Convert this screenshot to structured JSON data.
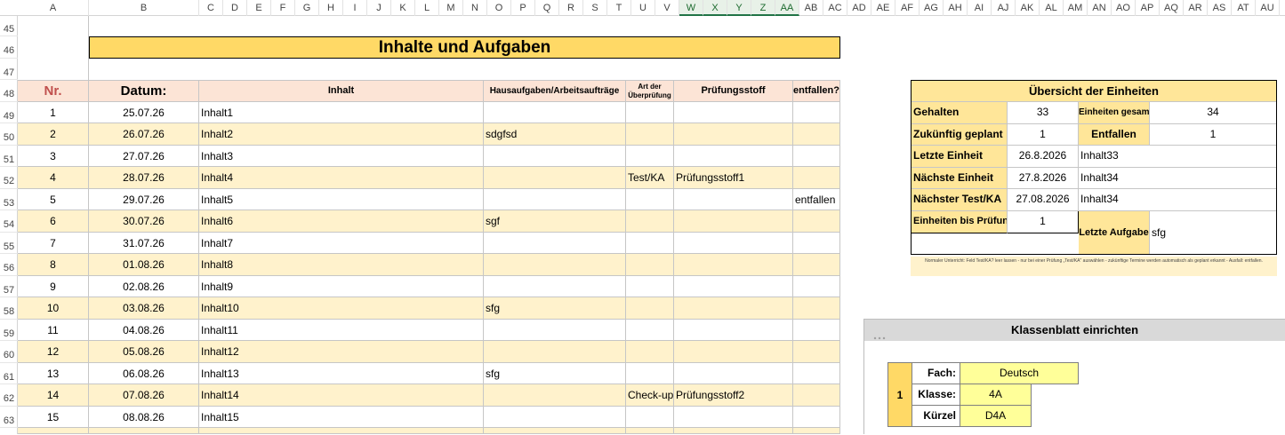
{
  "columns": [
    "A",
    "B",
    "C",
    "D",
    "E",
    "F",
    "G",
    "H",
    "I",
    "J",
    "K",
    "L",
    "M",
    "N",
    "O",
    "P",
    "Q",
    "R",
    "S",
    "T",
    "U",
    "V",
    "W",
    "X",
    "Y",
    "Z",
    "AA",
    "AB",
    "AC",
    "AD",
    "AE",
    "AF",
    "AG",
    "AH",
    "AI",
    "AJ",
    "AK",
    "AL",
    "AM",
    "AN",
    "AO",
    "AP",
    "AQ",
    "AR",
    "AS",
    "AT",
    "AU"
  ],
  "rows": [
    "45",
    "46",
    "47",
    "48",
    "49",
    "50",
    "51",
    "52",
    "53",
    "54",
    "55",
    "56",
    "57",
    "58",
    "59",
    "60",
    "61",
    "62",
    "63"
  ],
  "title": "Inhalte und Aufgaben",
  "table": {
    "headers": {
      "nr": "Nr.",
      "datum": "Datum:",
      "inhalt": "Inhalt",
      "hausaufgaben": "Hausaufgaben/Arbeitsaufträge",
      "art_line1": "Art der",
      "art_line2": "Überprüfung",
      "pruefungsstoff": "Prüfungsstoff",
      "entfallen": "entfallen?"
    },
    "rows": [
      {
        "nr": "1",
        "datum": "25.07.26",
        "inhalt": "Inhalt1",
        "ha": "",
        "art": "",
        "stoff": "",
        "entf": ""
      },
      {
        "nr": "2",
        "datum": "26.07.26",
        "inhalt": "Inhalt2",
        "ha": "sdgfsd",
        "art": "",
        "stoff": "",
        "entf": ""
      },
      {
        "nr": "3",
        "datum": "27.07.26",
        "inhalt": "Inhalt3",
        "ha": "",
        "art": "",
        "stoff": "",
        "entf": ""
      },
      {
        "nr": "4",
        "datum": "28.07.26",
        "inhalt": "Inhalt4",
        "ha": "",
        "art": "Test/KA",
        "stoff": "Prüfungsstoff1",
        "entf": ""
      },
      {
        "nr": "5",
        "datum": "29.07.26",
        "inhalt": "Inhalt5",
        "ha": "",
        "art": "",
        "stoff": "",
        "entf": "entfallen"
      },
      {
        "nr": "6",
        "datum": "30.07.26",
        "inhalt": "Inhalt6",
        "ha": "sgf",
        "art": "",
        "stoff": "",
        "entf": ""
      },
      {
        "nr": "7",
        "datum": "31.07.26",
        "inhalt": "Inhalt7",
        "ha": "",
        "art": "",
        "stoff": "",
        "entf": ""
      },
      {
        "nr": "8",
        "datum": "01.08.26",
        "inhalt": "Inhalt8",
        "ha": "",
        "art": "",
        "stoff": "",
        "entf": ""
      },
      {
        "nr": "9",
        "datum": "02.08.26",
        "inhalt": "Inhalt9",
        "ha": "",
        "art": "",
        "stoff": "",
        "entf": ""
      },
      {
        "nr": "10",
        "datum": "03.08.26",
        "inhalt": "Inhalt10",
        "ha": "sfg",
        "art": "",
        "stoff": "",
        "entf": ""
      },
      {
        "nr": "11",
        "datum": "04.08.26",
        "inhalt": "Inhalt11",
        "ha": "",
        "art": "",
        "stoff": "",
        "entf": ""
      },
      {
        "nr": "12",
        "datum": "05.08.26",
        "inhalt": "Inhalt12",
        "ha": "",
        "art": "",
        "stoff": "",
        "entf": ""
      },
      {
        "nr": "13",
        "datum": "06.08.26",
        "inhalt": "Inhalt13",
        "ha": "sfg",
        "art": "",
        "stoff": "",
        "entf": ""
      },
      {
        "nr": "14",
        "datum": "07.08.26",
        "inhalt": "Inhalt14",
        "ha": "",
        "art": "Check-up",
        "stoff": "Prüfungsstoff2",
        "entf": ""
      },
      {
        "nr": "15",
        "datum": "08.08.26",
        "inhalt": "Inhalt15",
        "ha": "",
        "art": "",
        "stoff": "",
        "entf": ""
      }
    ]
  },
  "overview": {
    "title": "Übersicht der Einheiten",
    "gehalten_label": "Gehalten",
    "gehalten_value": "33",
    "einheiten_gesamt_label": "Einheiten gesamt",
    "einheiten_gesamt_value": "34",
    "geplant_label": "Zukünftig geplant",
    "geplant_value": "1",
    "entfallen_label": "Entfallen",
    "entfallen_value": "1",
    "letzte_label": "Letzte Einheit",
    "letzte_date": "26.8.2026",
    "letzte_inhalt": "Inhalt33",
    "naechste_label": "Nächste Einheit",
    "naechste_date": "27.8.2026",
    "naechste_inhalt": "Inhalt34",
    "test_label": "Nächster Test/KA",
    "test_date": "27.08.2026",
    "test_inhalt": "Inhalt34",
    "bis_pruefung_label": "Einheiten bis Prüfung",
    "bis_pruefung_value": "1",
    "letzte_aufgabe_label": "Letzte Aufgabe",
    "letzte_aufgabe_value": "sfg",
    "note": "Normaler Unterricht: Feld Test/KA? leer lassen - nur bei einer Prüfung „Test/KA\" auswählen - zukünftige Termine werden automatisch als geplant erkannt - Ausfall: entfallen."
  },
  "klassenblatt": {
    "title": "Klassenblatt einrichten",
    "index": "1",
    "fach_label": "Fach:",
    "fach_value": "Deutsch",
    "klasse_label": "Klasse:",
    "klasse_value": "4A",
    "kuerzel_label": "Kürzel",
    "kuerzel_value": "D4A"
  },
  "colors": {
    "title_fill": "#ffd966",
    "header_fill": "#fce4d6",
    "band_fill": "#fff2cc",
    "selected_column_fill": "#e8f1e8"
  }
}
